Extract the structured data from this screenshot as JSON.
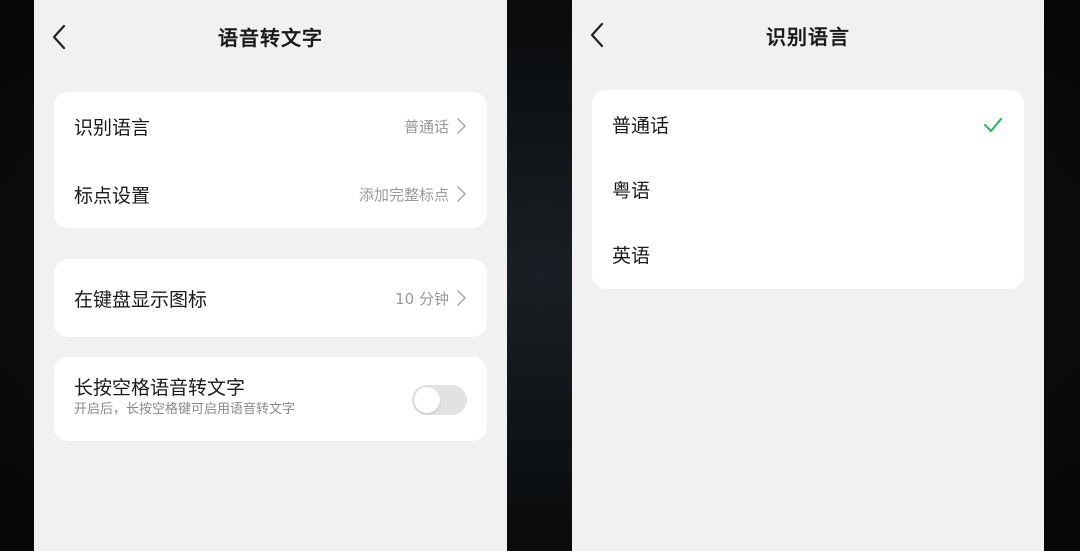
{
  "left_screen": {
    "title": "语音转文字",
    "recognition_language": {
      "label": "识别语言",
      "value": "普通话"
    },
    "punctuation": {
      "label": "标点设置",
      "value": "添加完整标点"
    },
    "keyboard_icon": {
      "label": "在键盘显示图标",
      "value": "10 分钟"
    },
    "space_hold": {
      "title": "长按空格语音转文字",
      "subtitle": "开启后，长按空格键可启用语音转文字",
      "enabled": false
    }
  },
  "right_screen": {
    "title": "识别语言",
    "options": [
      {
        "label": "普通话",
        "selected": true
      },
      {
        "label": "粤语",
        "selected": false
      },
      {
        "label": "英语",
        "selected": false
      }
    ]
  },
  "colors": {
    "accent": "#3bb56b",
    "panel_bg": "#f1f1f1",
    "card_bg": "#ffffff",
    "secondary_text": "#9a9a9a"
  },
  "icons": {
    "back": "chevron-left-icon",
    "row_chevron": "chevron-right-icon",
    "selected": "checkmark-icon"
  }
}
